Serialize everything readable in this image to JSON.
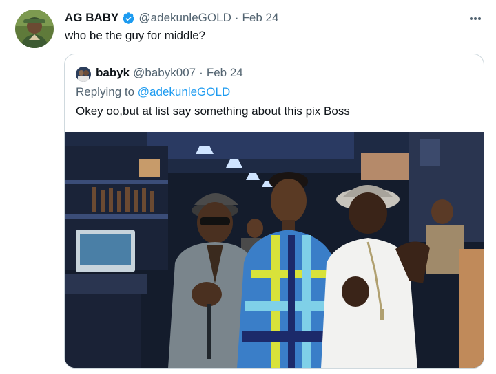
{
  "tweet": {
    "display_name": "AG BABY",
    "handle": "@adekunleGOLD",
    "separator": "·",
    "date": "Feb 24",
    "text": "who be the guy for middle?",
    "verified": true,
    "more_icon": "more-horizontal-icon"
  },
  "quoted": {
    "display_name": "babyk",
    "handle": "@babyk007",
    "separator": "·",
    "date": "Feb 24",
    "reply_prefix": "Replying to",
    "reply_to": "@adekunleGOLD",
    "text": "Okey oo,but at list say something about this pix Boss",
    "photo_subject": "three men posing in a bar"
  },
  "colors": {
    "link": "#1d9bf0",
    "secondary_text": "#536471",
    "primary_text": "#0f1419",
    "border": "#cfd9de"
  }
}
